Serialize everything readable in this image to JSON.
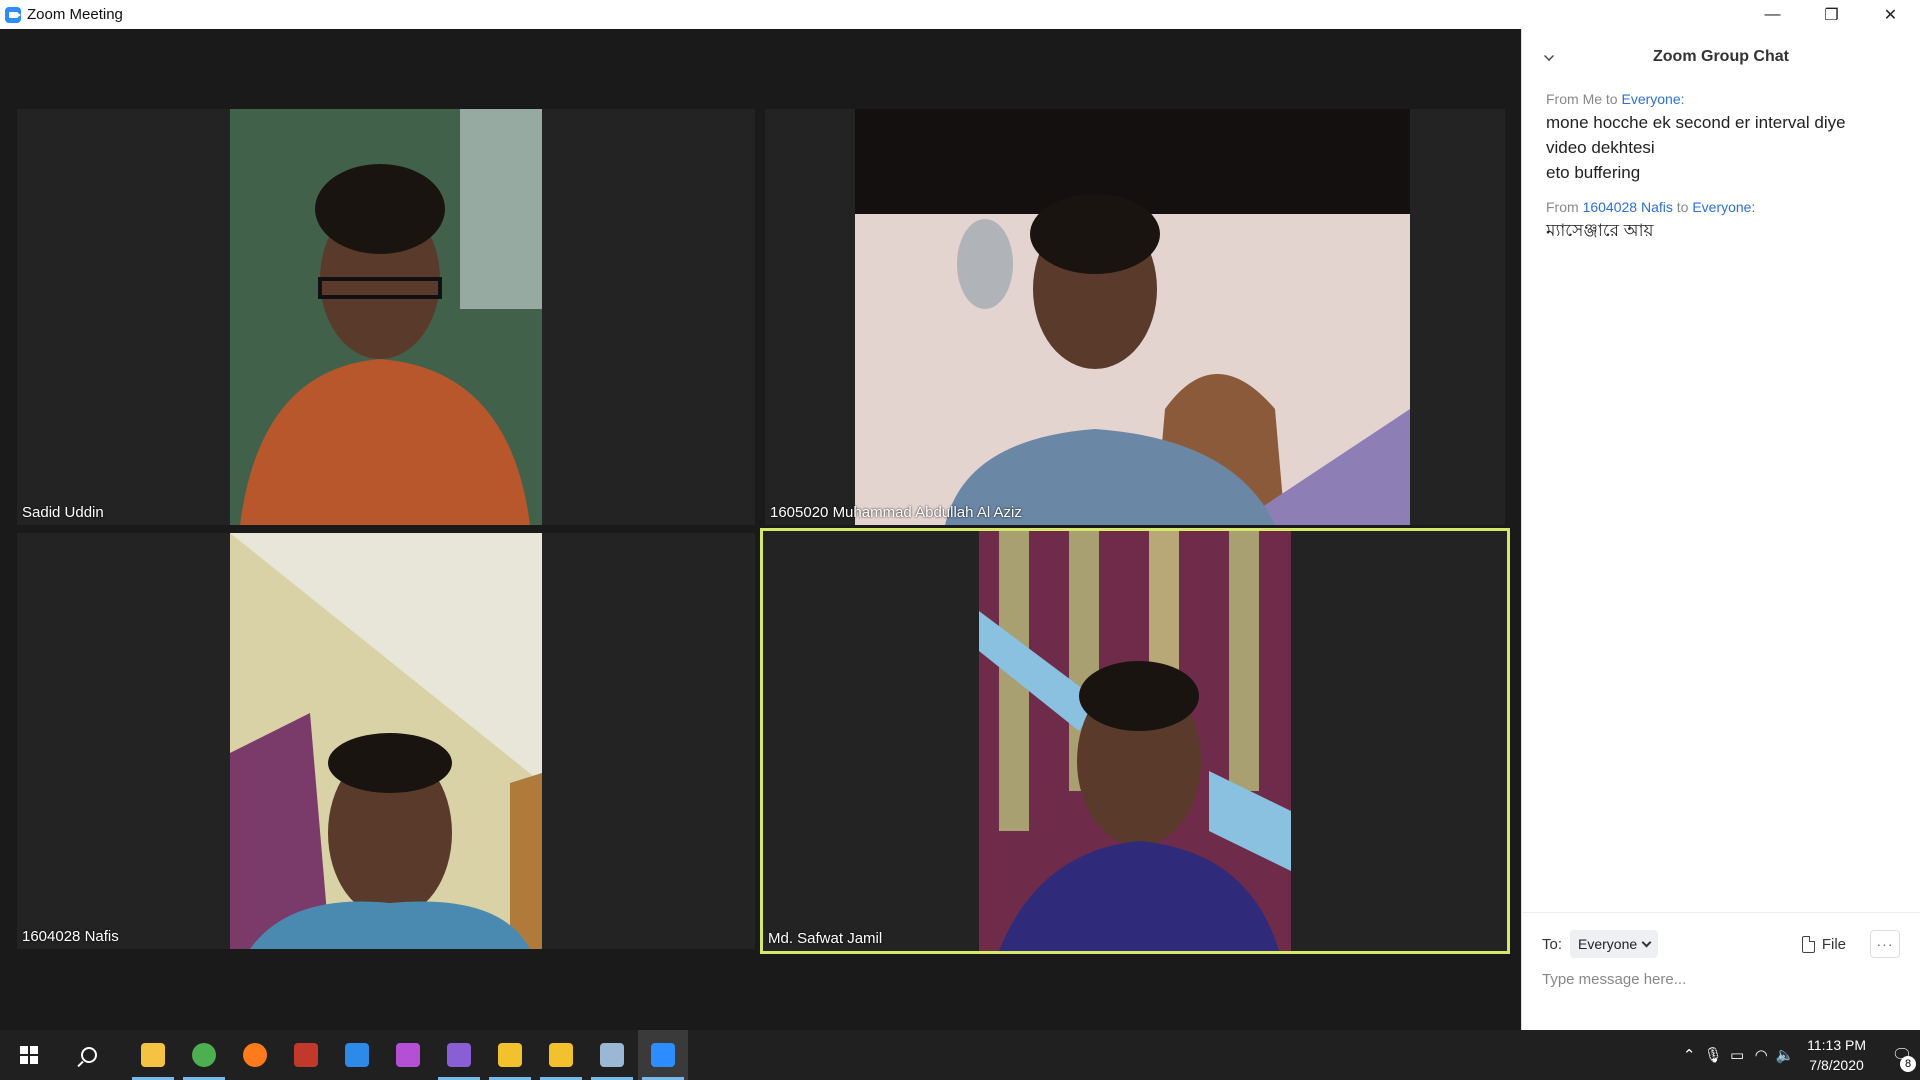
{
  "window": {
    "title": "Zoom Meeting",
    "controls": {
      "minimize": "—",
      "restore": "❐",
      "close": "✕"
    }
  },
  "participants": [
    {
      "name": "Sadid Uddin",
      "bg": "#4a6b55",
      "accent": "#b8572c"
    },
    {
      "name": "1605020 Muhammad Abdullah Al Aziz",
      "bg": "#e4d4d0",
      "accent": "#6b87a6"
    },
    {
      "name": "1604028 Nafis",
      "bg": "#d9d2a6",
      "accent": "#7a3a6a"
    },
    {
      "name": "Md. Safwat Jamil",
      "bg": "#6e2c4a",
      "accent": "#2f2a7a",
      "active": true
    }
  ],
  "chat": {
    "title": "Zoom Group Chat",
    "messages": [
      {
        "from_prefix": "From",
        "sender": "Me",
        "to_word": "to",
        "recipient": "Everyone:",
        "lines": [
          "mone hocche ek second er interval diye",
          "video dekhtesi",
          "eto buffering"
        ]
      },
      {
        "from_prefix": "From",
        "sender": "1604028 Nafis",
        "to_word": "to",
        "recipient": "Everyone:",
        "lines": [
          "ম্যাসেঞ্জারে আয়"
        ]
      }
    ],
    "to_label": "To:",
    "to_value": "Everyone",
    "file_label": "File",
    "more_label": "···",
    "input_placeholder": "Type message here..."
  },
  "taskbar": {
    "apps": [
      {
        "name": "file-explorer",
        "color": "#f5c242",
        "running": true
      },
      {
        "name": "chrome",
        "color": "#4caf50",
        "running": true
      },
      {
        "name": "firefox",
        "color": "#ff7a1a",
        "running": false
      },
      {
        "name": "winrar",
        "color": "#c0392b",
        "running": false
      },
      {
        "name": "vscode",
        "color": "#2d8ae8",
        "running": false
      },
      {
        "name": "phpstorm",
        "color": "#b44fd6",
        "running": false
      },
      {
        "name": "visual-studio",
        "color": "#8a5fd6",
        "running": true
      },
      {
        "name": "cyberduck-1",
        "color": "#f2c12e",
        "running": true
      },
      {
        "name": "cyberduck-2",
        "color": "#f2c12e",
        "running": true
      },
      {
        "name": "paint",
        "color": "#9ab8d6",
        "running": true
      },
      {
        "name": "zoom",
        "color": "#2d8cff",
        "running": true,
        "focused": true
      }
    ],
    "clock_time": "11:13 PM",
    "clock_date": "7/8/2020",
    "notification_count": "8"
  }
}
